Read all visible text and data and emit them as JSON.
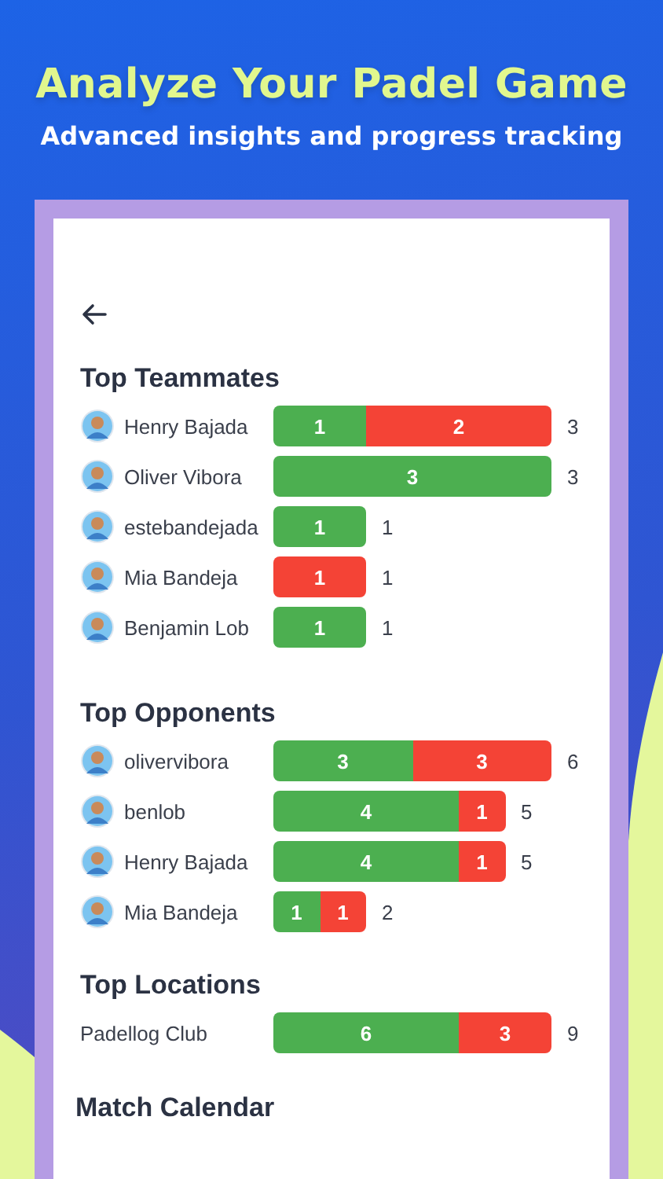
{
  "header": {
    "title": "Analyze Your Padel Game",
    "subtitle": "Advanced insights and progress tracking"
  },
  "sections": [
    {
      "title": "Top Teammates",
      "rows": [
        {
          "kind": "player",
          "name": "Henry Bajada",
          "segments": [
            {
              "kind": "win",
              "label": "1"
            },
            {
              "kind": "loss",
              "label": "2"
            }
          ],
          "total": "3"
        },
        {
          "kind": "player",
          "name": "Oliver Vibora",
          "segments": [
            {
              "kind": "win",
              "label": "3"
            }
          ],
          "total": "3"
        },
        {
          "kind": "player",
          "name": "estebandejada",
          "segments": [
            {
              "kind": "win",
              "label": "1"
            }
          ],
          "total": "1"
        },
        {
          "kind": "player",
          "name": "Mia Bandeja",
          "segments": [
            {
              "kind": "loss",
              "label": "1"
            }
          ],
          "total": "1"
        },
        {
          "kind": "player",
          "name": "Benjamin Lob",
          "segments": [
            {
              "kind": "win",
              "label": "1"
            }
          ],
          "total": "1"
        }
      ]
    },
    {
      "title": "Top Opponents",
      "rows": [
        {
          "kind": "player",
          "name": "olivervibora",
          "segments": [
            {
              "kind": "win",
              "label": "3"
            },
            {
              "kind": "loss",
              "label": "3"
            }
          ],
          "total": "6"
        },
        {
          "kind": "player",
          "name": "benlob",
          "segments": [
            {
              "kind": "win",
              "label": "4"
            },
            {
              "kind": "loss",
              "label": "1"
            }
          ],
          "total": "5"
        },
        {
          "kind": "player",
          "name": "Henry Bajada",
          "segments": [
            {
              "kind": "win",
              "label": "4"
            },
            {
              "kind": "loss",
              "label": "1"
            }
          ],
          "total": "5"
        },
        {
          "kind": "player",
          "name": "Mia Bandeja",
          "segments": [
            {
              "kind": "win",
              "label": "1"
            },
            {
              "kind": "loss",
              "label": "1"
            }
          ],
          "total": "2"
        }
      ]
    },
    {
      "title": "Top Locations",
      "rows": [
        {
          "kind": "location",
          "name": "Padellog Club",
          "segments": [
            {
              "kind": "win",
              "label": "6"
            },
            {
              "kind": "loss",
              "label": "3"
            }
          ],
          "total": "9"
        }
      ]
    }
  ],
  "footer_title": "Match Calendar"
}
